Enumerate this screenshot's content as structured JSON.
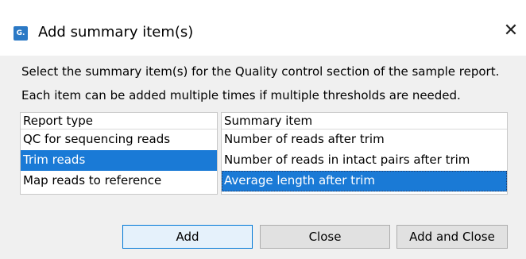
{
  "window": {
    "title": "Add summary item(s)",
    "app_icon_label": "G.",
    "close_glyph": "✕"
  },
  "description": {
    "line1": "Select the summary item(s) for the Quality control section of the sample report.",
    "line2": "Each item can be added multiple times if multiple thresholds are needed."
  },
  "report_types": {
    "header": "Report type",
    "items": [
      {
        "label": "QC for sequencing reads",
        "selected": false
      },
      {
        "label": "Trim reads",
        "selected": true
      },
      {
        "label": "Map reads to reference",
        "selected": false
      }
    ]
  },
  "summary_items": {
    "header": "Summary item",
    "items": [
      {
        "label": "Number of reads after trim",
        "selected": false
      },
      {
        "label": "Number of reads in intact pairs after trim",
        "selected": false
      },
      {
        "label": "Average length after trim",
        "selected": true
      }
    ]
  },
  "buttons": {
    "add": "Add",
    "close": "Close",
    "add_and_close": "Add and Close"
  },
  "colors": {
    "selection": "#1a7ad6",
    "default_button_border": "#0078d7"
  }
}
